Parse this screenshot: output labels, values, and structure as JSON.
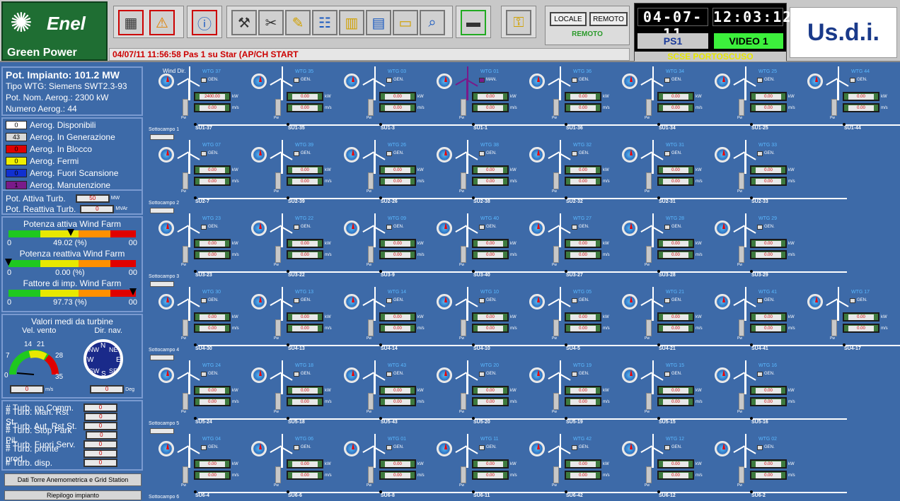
{
  "top": {
    "brand": "Enel",
    "brand_sub": "Green Power",
    "status": "04/07/11 11:56:58 Pas 1 su Star (AP/CH  START",
    "mode": {
      "locale": "LOCALE",
      "remoto": "REMOTO",
      "active": "REMOTO"
    },
    "date_lcd": "04-07-11",
    "time_lcd": "12:03:12",
    "ps": "PS1",
    "video": "VIDEO 1",
    "site": "SCSE PORTOSCUSO",
    "logo_right": "Us.d.i."
  },
  "plant": {
    "title": "Pot. Impianto: 101.2 MW",
    "tipo": "Tipo WTG: Siemens SWT2.3-93",
    "pot_nom": "Pot. Nom. Aerog.: 2300 kW",
    "numero": "Numero Aerog.: 44"
  },
  "legend": [
    {
      "count": "0",
      "label": "Aerog. Disponibili",
      "color": "#ffffff"
    },
    {
      "count": "43",
      "label": "Aerog. In Generazione",
      "color": "#d8d8d8"
    },
    {
      "count": "0",
      "label": "Aerog. In Blocco",
      "color": "#e00000"
    },
    {
      "count": "0",
      "label": "Aerog. Fermi",
      "color": "#f0f000"
    },
    {
      "count": "0",
      "label": "Aerog. Fuori Scansione",
      "color": "#1030d0"
    },
    {
      "count": "1",
      "label": "Aerog. Manutenzione",
      "color": "#7a1a8a"
    }
  ],
  "pot": {
    "attiva_label": "Pot. Attiva Turb.",
    "attiva_val": "50",
    "attiva_unit": "MW",
    "reattiva_label": "Pot. Reattiva Turb.",
    "reattiva_val": "0",
    "reattiva_unit": "MVAr"
  },
  "gauges": [
    {
      "title": "Potenza attiva Wind Farm",
      "min": "0",
      "value": "49.02 (%)",
      "max": "00",
      "level": 0.49
    },
    {
      "title": "Potenza reattiva Wind Farm",
      "min": "0",
      "value": "0.00 (%)",
      "max": "00",
      "level": 0.0
    },
    {
      "title": "Fattore di imp. Wind Farm",
      "min": "0",
      "value": "97.73 (%)",
      "max": "00",
      "level": 0.98
    }
  ],
  "medi": {
    "title": "Valori medi da turbine",
    "vel_label": "Vel. vento",
    "dir_label": "Dir. nav.",
    "scale": [
      "0",
      "7",
      "14",
      "21",
      "28",
      "35"
    ],
    "compass": [
      "N",
      "NE",
      "E",
      "SE",
      "S",
      "SW",
      "W",
      "NW"
    ],
    "vel_val": "0",
    "vel_unit": "m/s",
    "dir_val": "0",
    "dir_unit": "Deg"
  },
  "counters": [
    {
      "label": "# Turb. no Comm.",
      "val": "0"
    },
    {
      "label": "# Turb. Man. Rst St.",
      "val": "0"
    },
    {
      "label": "# Turb. Aut. Rst St.",
      "val": "0"
    },
    {
      "label": "# Turb. Stop Park Pil.",
      "val": "0"
    },
    {
      "label": "# Turb. Fuori Serv.",
      "val": "0"
    },
    {
      "label": "# Turb. pronte prod.",
      "val": "0"
    },
    {
      "label": "# Turb. disp.",
      "val": "0"
    }
  ],
  "buttons": {
    "dati_torre": "Dati Torre Anemometrica e Grid Station",
    "riepilogo": "Riepilogo impianto"
  },
  "main": {
    "wind_dir": "Wind Dir.",
    "gen": "GEN.",
    "man": "MAN.",
    "kw": "kW",
    "ms": "m/s",
    "pw": "Pw",
    "rows": [
      {
        "sotto": "Sottocampo 1",
        "turbines": [
          {
            "name": "WTG 37",
            "su": "SU1-37",
            "kw": "2400.00",
            "ms": "0.00",
            "state": "gen"
          },
          {
            "name": "WTG 35",
            "su": "SU1-35",
            "kw": "0.00",
            "ms": "0.00",
            "state": "gen"
          },
          {
            "name": "WTG 03",
            "su": "SU1-3",
            "kw": "0.00",
            "ms": "0.00",
            "state": "gen"
          },
          {
            "name": "WTG 01",
            "su": "SU1-1",
            "kw": "0.00",
            "ms": "0.00",
            "state": "man"
          },
          {
            "name": "WTG 36",
            "su": "SU1-36",
            "kw": "0.00",
            "ms": "0.00",
            "state": "gen"
          },
          {
            "name": "WTG 34",
            "su": "SU1-34",
            "kw": "0.00",
            "ms": "0.00",
            "state": "gen"
          },
          {
            "name": "WTG 25",
            "su": "SU1-25",
            "kw": "0.00",
            "ms": "0.00",
            "state": "gen"
          },
          {
            "name": "WTG 44",
            "su": "SU1-44",
            "kw": "0.00",
            "ms": "0.00",
            "state": "gen"
          }
        ]
      },
      {
        "sotto": "Sottocampo 2",
        "turbines": [
          {
            "name": "WTG 07",
            "su": "SU2-7",
            "kw": "0.00",
            "ms": "0.00",
            "state": "gen"
          },
          {
            "name": "WTG 39",
            "su": "SU2-39",
            "kw": "0.00",
            "ms": "0.00",
            "state": "gen"
          },
          {
            "name": "WTG 26",
            "su": "SU2-26",
            "kw": "0.00",
            "ms": "0.00",
            "state": "gen"
          },
          {
            "name": "WTG 38",
            "su": "SU2-38",
            "kw": "0.00",
            "ms": "0.00",
            "state": "gen"
          },
          {
            "name": "WTG 32",
            "su": "SU2-32",
            "kw": "0.00",
            "ms": "0.00",
            "state": "gen"
          },
          {
            "name": "WTG 31",
            "su": "SU2-31",
            "kw": "0.00",
            "ms": "0.00",
            "state": "gen"
          },
          {
            "name": "WTG 33",
            "su": "SU2-33",
            "kw": "0.00",
            "ms": "0.00",
            "state": "gen"
          }
        ]
      },
      {
        "sotto": "Sottocampo 3",
        "turbines": [
          {
            "name": "WTG 23",
            "su": "SU3-23",
            "kw": "0.00",
            "ms": "0.00",
            "state": "gen"
          },
          {
            "name": "WTG 22",
            "su": "SU3-22",
            "kw": "0.00",
            "ms": "0.00",
            "state": "gen"
          },
          {
            "name": "WTG 09",
            "su": "SU3-9",
            "kw": "0.00",
            "ms": "0.00",
            "state": "gen"
          },
          {
            "name": "WTG 40",
            "su": "SU3-40",
            "kw": "0.00",
            "ms": "0.00",
            "state": "gen"
          },
          {
            "name": "WTG 27",
            "su": "SU3-27",
            "kw": "0.00",
            "ms": "0.00",
            "state": "gen"
          },
          {
            "name": "WTG 28",
            "su": "SU3-28",
            "kw": "0.00",
            "ms": "0.00",
            "state": "gen"
          },
          {
            "name": "WTG 29",
            "su": "SU3-29",
            "kw": "0.00",
            "ms": "0.00",
            "state": "gen"
          }
        ]
      },
      {
        "sotto": "Sottocampo 4",
        "turbines": [
          {
            "name": "WTG 30",
            "su": "SU4-30",
            "kw": "0.00",
            "ms": "0.00",
            "state": "gen"
          },
          {
            "name": "WTG 13",
            "su": "SU4-13",
            "kw": "0.00",
            "ms": "0.00",
            "state": "gen"
          },
          {
            "name": "WTG 14",
            "su": "SU4-14",
            "kw": "0.00",
            "ms": "0.00",
            "state": "gen"
          },
          {
            "name": "WTG 10",
            "su": "SU4-10",
            "kw": "0.00",
            "ms": "0.00",
            "state": "gen"
          },
          {
            "name": "WTG 05",
            "su": "SU4-5",
            "kw": "0.00",
            "ms": "0.00",
            "state": "gen"
          },
          {
            "name": "WTG 21",
            "su": "SU4-21",
            "kw": "0.00",
            "ms": "0.00",
            "state": "gen"
          },
          {
            "name": "WTG 41",
            "su": "SU4-41",
            "kw": "0.00",
            "ms": "0.00",
            "state": "gen"
          },
          {
            "name": "WTG 17",
            "su": "SU4-17",
            "kw": "0.00",
            "ms": "0.00",
            "state": "gen"
          }
        ]
      },
      {
        "sotto": "Sottocampo 5",
        "turbines": [
          {
            "name": "WTG 24",
            "su": "SU5-24",
            "kw": "0.00",
            "ms": "0.00",
            "state": "gen"
          },
          {
            "name": "WTG 18",
            "su": "SU5-18",
            "kw": "0.00",
            "ms": "0.00",
            "state": "gen"
          },
          {
            "name": "WTG 43",
            "su": "SU5-43",
            "kw": "0.00",
            "ms": "0.00",
            "state": "gen"
          },
          {
            "name": "WTG 20",
            "su": "SU5-20",
            "kw": "0.00",
            "ms": "0.00",
            "state": "gen"
          },
          {
            "name": "WTG 19",
            "su": "SU5-19",
            "kw": "0.00",
            "ms": "0.00",
            "state": "gen"
          },
          {
            "name": "WTG 15",
            "su": "SU5-15",
            "kw": "0.00",
            "ms": "0.00",
            "state": "gen"
          },
          {
            "name": "WTG 16",
            "su": "SU5-16",
            "kw": "0.00",
            "ms": "0.00",
            "state": "gen"
          }
        ]
      },
      {
        "sotto": "Sottocampo 6",
        "turbines": [
          {
            "name": "WTG 04",
            "su": "SU6-4",
            "kw": "0.00",
            "ms": "0.00",
            "state": "gen"
          },
          {
            "name": "WTG 06",
            "su": "SU6-6",
            "kw": "0.00",
            "ms": "0.00",
            "state": "gen"
          },
          {
            "name": "WTG 01",
            "su": "SU6-8",
            "kw": "0.00",
            "ms": "0.00",
            "state": "gen"
          },
          {
            "name": "WTG 11",
            "su": "SU6-11",
            "kw": "0.00",
            "ms": "0.00",
            "state": "gen"
          },
          {
            "name": "WTG 42",
            "su": "SU6-42",
            "kw": "0.00",
            "ms": "0.00",
            "state": "gen"
          },
          {
            "name": "WTG 12",
            "su": "SU6-12",
            "kw": "0.00",
            "ms": "0.00",
            "state": "gen"
          },
          {
            "name": "WTG 02",
            "su": "SU6-2",
            "kw": "0.00",
            "ms": "0.00",
            "state": "gen"
          }
        ]
      }
    ]
  }
}
